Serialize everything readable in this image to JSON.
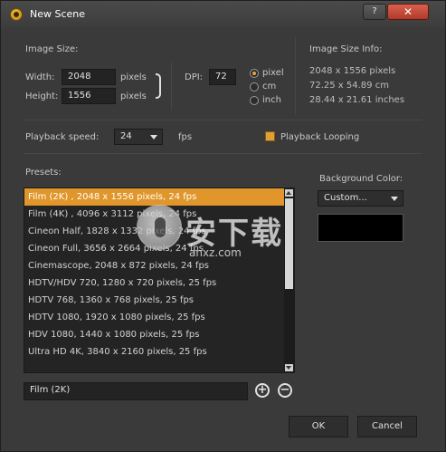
{
  "window": {
    "title": "New Scene",
    "help_label": "?",
    "close_label": "✕"
  },
  "image_size": {
    "section_label": "Image Size:",
    "width_label": "Width:",
    "width_value": "2048",
    "height_label": "Height:",
    "height_value": "1556",
    "width_unit": "pixels",
    "height_unit": "pixels",
    "dpi_label": "DPI:",
    "dpi_value": "72",
    "units": [
      {
        "label": "pixel",
        "selected": true
      },
      {
        "label": "cm",
        "selected": false
      },
      {
        "label": "inch",
        "selected": false
      }
    ]
  },
  "image_size_info": {
    "section_label": "Image Size Info:",
    "pixels": "2048 x 1556 pixels",
    "cm": "72.25 x 54.89 cm",
    "inches": "28.44 x 21.61 inches"
  },
  "playback": {
    "speed_label": "Playback speed:",
    "speed_value": "24",
    "unit": "fps",
    "looping_label": "Playback Looping",
    "looping_checked": true
  },
  "presets": {
    "section_label": "Presets:",
    "items": [
      "Film (2K) , 2048 x 1556 pixels, 24 fps",
      "Film (4K) , 4096 x 3112 pixels, 24 fps",
      "Cineon Half, 1828 x 1332 pixels, 24 fps",
      "Cineon Full, 3656 x 2664 pixels, 24 fps",
      "Cinemascope, 2048 x 872 pixels, 24 fps",
      "HDTV/HDV 720, 1280 x 720 pixels, 25 fps",
      "HDTV 768, 1360 x 768 pixels, 25 fps",
      "HDTV 1080, 1920 x 1080 pixels, 25 fps",
      "HDV 1080, 1440 x 1080 pixels, 25 fps",
      "Ultra HD 4K, 3840 x 2160 pixels, 25 fps"
    ],
    "selected_index": 0,
    "name_value": "Film (2K)",
    "add_label": "+",
    "remove_label": "−"
  },
  "background": {
    "label": "Background Color:",
    "mode_value": "Custom...",
    "color": "#000000"
  },
  "watermark": {
    "text": "安下载",
    "sub": "anxz.com"
  },
  "buttons": {
    "ok": "OK",
    "cancel": "Cancel"
  },
  "colors": {
    "accent": "#e0962a",
    "bg": "#3a3a3a",
    "close": "#c0483a"
  }
}
